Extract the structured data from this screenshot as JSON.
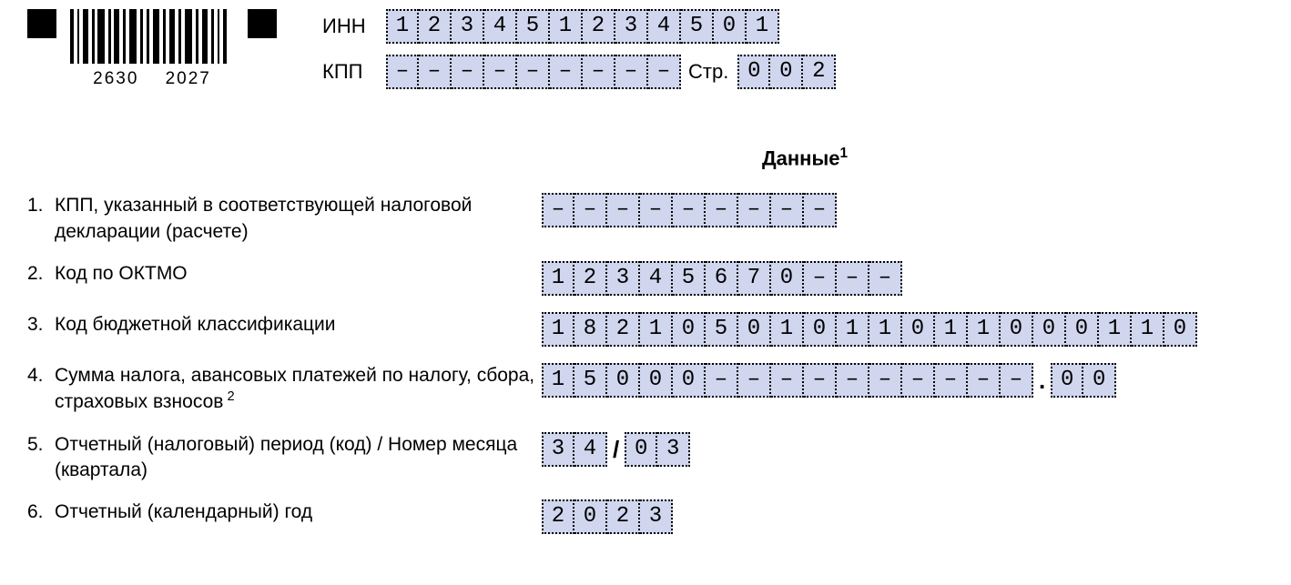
{
  "barcode": {
    "left": "2630",
    "right": "2027"
  },
  "header": {
    "inn_label": "ИНН",
    "inn": "123451234501",
    "kpp_label": "КПП",
    "kpp": "---------",
    "page_label": "Стр.",
    "page": "002"
  },
  "section_title": "Данные",
  "section_title_sup": "1",
  "rows": [
    {
      "n": "1.",
      "label": "КПП, указанный в соответствующей налоговой декларации (расчете)",
      "cells": [
        "---------"
      ]
    },
    {
      "n": "2.",
      "label": "Код по ОКТМО",
      "cells": [
        "12345670---"
      ]
    },
    {
      "n": "3.",
      "label": "Код бюджетной классификации",
      "cells": [
        "18210501011011000110"
      ]
    },
    {
      "n": "4.",
      "label": "Сумма налога, авансовых платежей по налогу, сбора, страховых взносов",
      "sup": "2",
      "cells": [
        "15000----------",
        ".",
        "00"
      ]
    },
    {
      "n": "5.",
      "label": "Отчетный (налоговый) период (код) / Номер месяца (квартала)",
      "cells": [
        "34",
        "/",
        "03"
      ]
    },
    {
      "n": "6.",
      "label": "Отчетный (календарный) год",
      "cells": [
        "2023"
      ]
    }
  ]
}
